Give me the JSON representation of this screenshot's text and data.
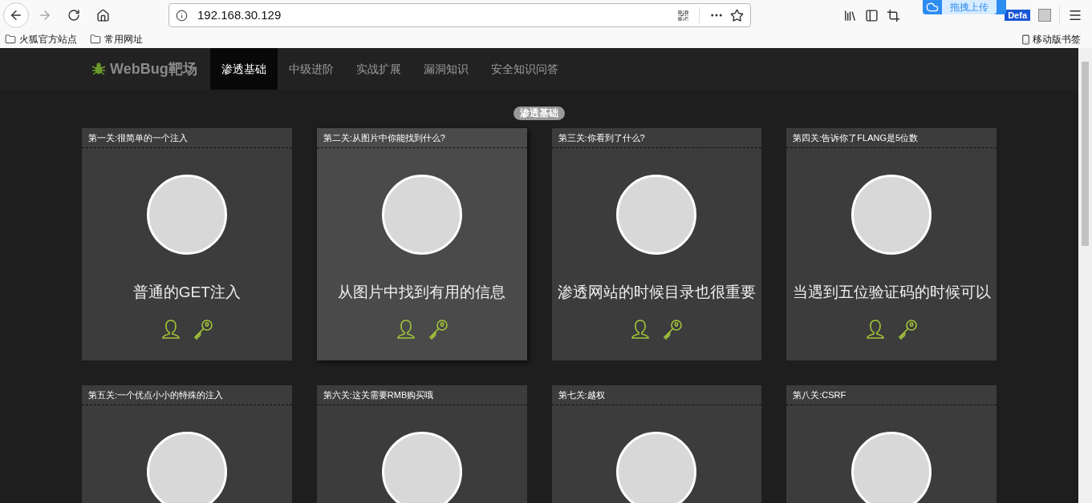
{
  "browser": {
    "url": "192.168.30.129",
    "bookmarks": [
      "火狐官方站点",
      "常用网址"
    ],
    "mobile_bookmarks": "移动版书签",
    "upload_popup": "拖拽上传",
    "extension_badge": "Defa"
  },
  "site": {
    "logo": "WebBug靶场",
    "nav": [
      {
        "label": "渗透基础",
        "selected": true
      },
      {
        "label": "中级进阶",
        "selected": false
      },
      {
        "label": "实战扩展",
        "selected": false
      },
      {
        "label": "漏洞知识",
        "selected": false
      },
      {
        "label": "安全知识问答",
        "selected": false
      }
    ],
    "section_badge": "渗透基础",
    "cards": [
      {
        "title": "第一关:很简单的一个注入",
        "caption": "普通的GET注入",
        "highlighted": false
      },
      {
        "title": "第二关:从图片中你能找到什么?",
        "caption": "从图片中找到有用的信息",
        "highlighted": true
      },
      {
        "title": "第三关:你看到了什么?",
        "caption": "渗透网站的时候目录也很重要",
        "highlighted": false
      },
      {
        "title": "第四关:告诉你了FLANG是5位数",
        "caption": "当遇到五位验证码的时候可以",
        "highlighted": false
      },
      {
        "title": "第五关:一个优点小小的特殊的注入",
        "highlighted": false
      },
      {
        "title": "第六关:这关需要RMB购买哦",
        "highlighted": false
      },
      {
        "title": "第七关:越权",
        "highlighted": false
      },
      {
        "title": "第八关:CSRF",
        "highlighted": false
      }
    ]
  }
}
